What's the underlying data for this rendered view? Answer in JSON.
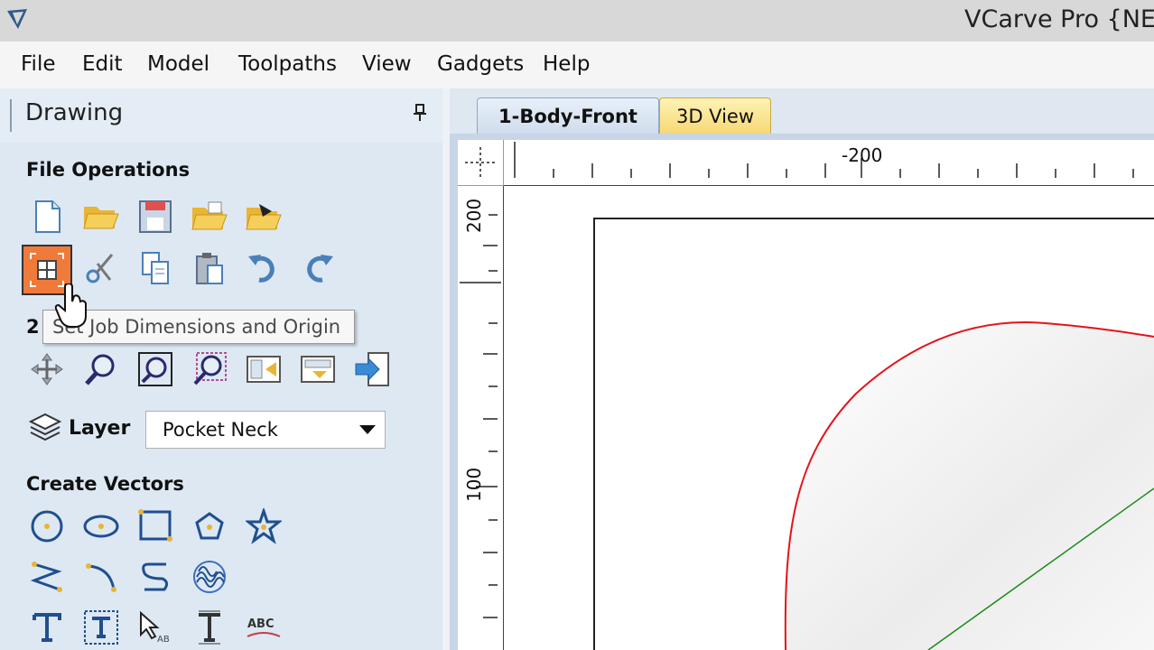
{
  "window": {
    "title": "VCarve Pro {NE"
  },
  "menu": [
    "File",
    "Edit",
    "Model",
    "Toolpaths",
    "View",
    "Gadgets",
    "Help"
  ],
  "panel": {
    "title": "Drawing",
    "sections": {
      "file_operations": "File Operations",
      "view_section_partial": "2",
      "create_vectors": "Create Vectors"
    },
    "file_ops_row1": [
      "new-file-icon",
      "open-folder-icon",
      "save-icon",
      "open-recent-icon",
      "import-icon"
    ],
    "file_ops_row2": [
      "job-setup-icon",
      "cut-icon",
      "copy-icon",
      "paste-icon",
      "undo-icon",
      "redo-icon"
    ],
    "view_tools": [
      "pan-icon",
      "zoom-icon",
      "zoom-all-icon",
      "zoom-selection-icon",
      "view-toggle-icon",
      "align-icon",
      "import-vectors-icon"
    ],
    "tooltip": "Set Job Dimensions and Origin",
    "layer": {
      "label": "Layer",
      "value": "Pocket Neck"
    },
    "vector_rows": [
      [
        "circle-icon",
        "ellipse-icon",
        "rectangle-icon",
        "polygon-icon",
        "star-icon"
      ],
      [
        "polyline-icon",
        "arc-icon",
        "curve-icon",
        "spiral-icon"
      ],
      [
        "text-icon",
        "text-box-icon",
        "text-select-icon",
        "text-spacing-icon",
        "text-arc-icon"
      ]
    ]
  },
  "view": {
    "tabs": [
      {
        "label": "1-Body-Front",
        "active": true
      },
      {
        "label": "3D View",
        "active": false
      }
    ],
    "ruler_h_label": "-200",
    "ruler_v_labels": [
      "200",
      "100"
    ]
  },
  "colors": {
    "panel_bg": "#dde8f3",
    "selected_tool": "#f07a3a",
    "vector_red": "#e0161b",
    "vector_green": "#1a8a1a",
    "tab_3d": "#f6d774"
  }
}
